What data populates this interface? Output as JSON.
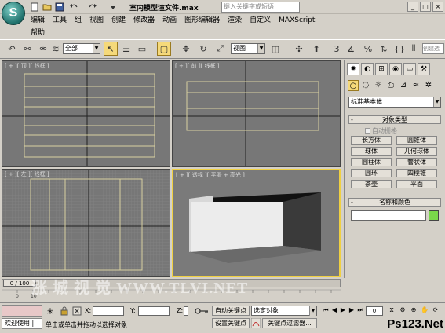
{
  "app": {
    "title": "室内模型渲文件.max",
    "search_placeholder": "键入关键字或短语",
    "window_buttons": [
      "_",
      "□",
      "×"
    ]
  },
  "menu": {
    "items": [
      "编辑",
      "工具",
      "组",
      "视图",
      "创建",
      "修改器",
      "动画",
      "图形编辑器",
      "渲染",
      "自定义",
      "MAXScript"
    ],
    "help": "帮助"
  },
  "toolbar": {
    "selection_filter": "全部",
    "reference_coord": "视图",
    "snap_number": "3",
    "create_selection_placeholder": "创建选择"
  },
  "viewports": {
    "top": "[ + ][ 顶 ][ 线框 ]",
    "front": "[ + ][ 前 ][ 线框 ]",
    "left": "[ + ][ 左 ][ 线框 ]",
    "perspective": "[ + ][ 透视 ][ 平滑 + 高光 ]"
  },
  "command_panel": {
    "category": "标准基本体",
    "object_type_header": "对象类型",
    "autogrid_label": "自动栅格",
    "objects": [
      "长方体",
      "圆锥体",
      "球体",
      "几何球体",
      "圆柱体",
      "管状体",
      "圆环",
      "四棱锥",
      "茶壶",
      "平面"
    ],
    "name_color_header": "名称和颜色",
    "object_color": "#7ad84a"
  },
  "timeline": {
    "slider": "0 / 100",
    "ticks": [
      "0",
      "10"
    ]
  },
  "status": {
    "welcome": "欢迎使用 |",
    "selection_label": "未",
    "x_label": "X:",
    "y_label": "Y:",
    "z_label": "Z:",
    "prompt": "单击或单击并拖动以选择对象",
    "auto_key": "自动关键点",
    "set_key": "设置关键点",
    "key_mode": "选定对象",
    "key_filters": "关键点过滤器...",
    "frame": "0"
  },
  "watermark": "涨 城 视 觉 WWW.TLVI.NET",
  "corner_logo": "Ps123.Net"
}
